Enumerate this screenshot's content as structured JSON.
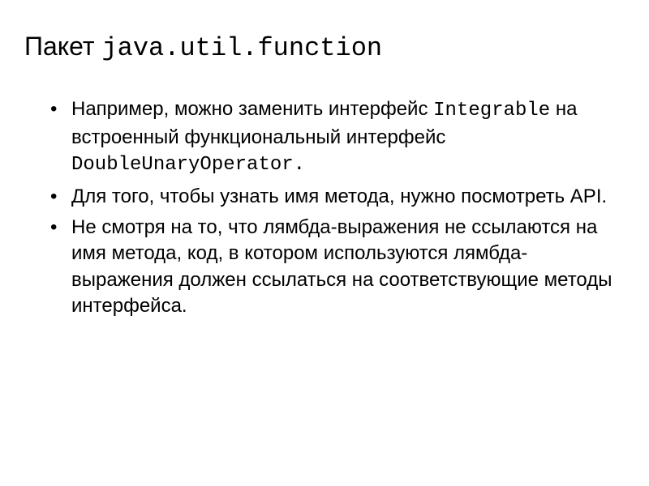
{
  "title": {
    "prefix": "Пакет ",
    "code": "java.util.function"
  },
  "bullets": [
    {
      "parts": [
        {
          "t": "text",
          "v": "Например, можно заменить интерфейс "
        },
        {
          "t": "mono",
          "v": "Integrable"
        },
        {
          "t": "text",
          "v": " на встроенный функциональный интерфейс "
        },
        {
          "t": "mono",
          "v": "DoubleUnaryOperator."
        }
      ]
    },
    {
      "parts": [
        {
          "t": "text",
          "v": "Для того, чтобы узнать имя метода, нужно посмотреть API."
        }
      ]
    },
    {
      "parts": [
        {
          "t": "text",
          "v": "Не смотря на то, что лямбда-выражения не ссылаются на имя метода, код, в котором используются лямбда-выражения должен ссылаться на соответствующие методы интерфейса."
        }
      ]
    }
  ]
}
